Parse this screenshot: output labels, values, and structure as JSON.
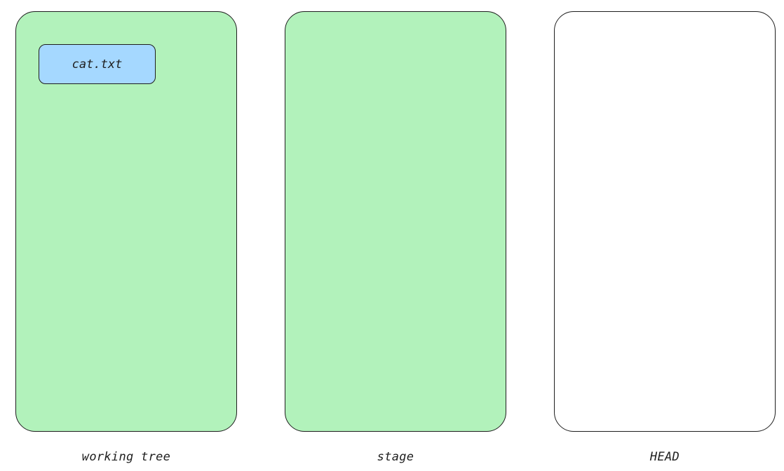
{
  "areas": [
    {
      "label": "working tree",
      "fill": "#b2f2bb",
      "files": [
        "cat.txt"
      ]
    },
    {
      "label": "stage",
      "fill": "#b2f2bb",
      "files": []
    },
    {
      "label": "HEAD",
      "fill": "#ffffff",
      "files": []
    }
  ],
  "colors": {
    "file_fill": "#a5d8ff",
    "stroke": "#1e1e1e"
  }
}
